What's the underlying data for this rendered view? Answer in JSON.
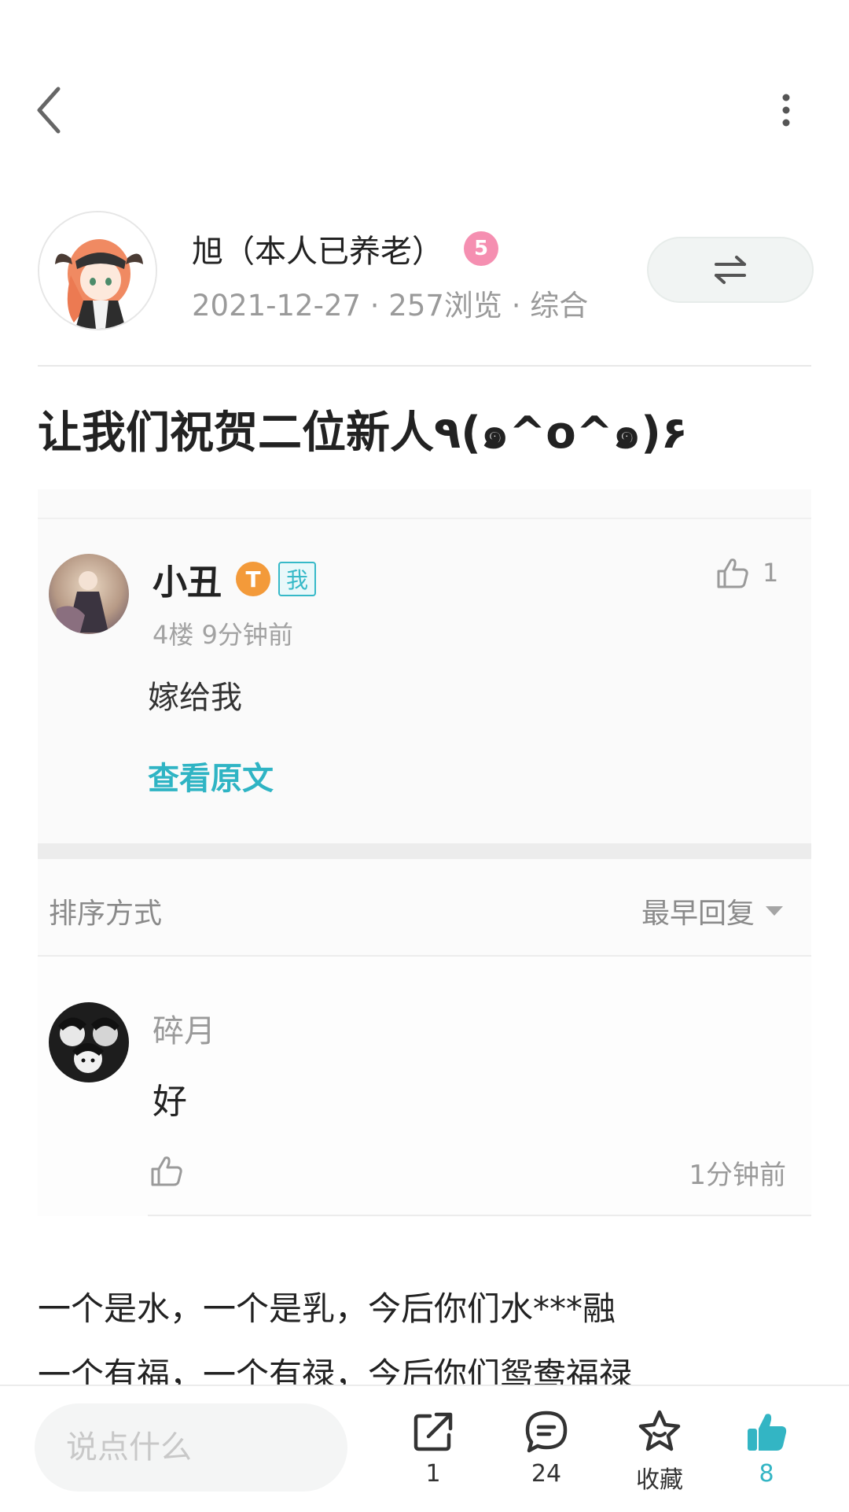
{
  "topbar": {
    "back_icon": "chevron-left-icon",
    "more_icon": "more-vertical-icon"
  },
  "author": {
    "name": "旭（本人已养老）",
    "level_badge": "5",
    "meta": "2021-12-27 · 257浏览 · 综合",
    "follow_icon": "swap-arrows-icon"
  },
  "post": {
    "title": "让我们祝贺二位新人٩(๑^o^๑)۶",
    "body_lines": [
      "一个是水，一个是乳，今后你们水***融",
      "一个有福，一个有禄，今后你们鸳鸯福禄"
    ]
  },
  "quoted_reply": {
    "name": "小丑",
    "level_badge": "T",
    "me_badge": "我",
    "meta": "4楼   9分钟前",
    "text": "嫁给我",
    "view_original": "查看原文",
    "like_count": "1"
  },
  "sort": {
    "label": "排序方式",
    "value": "最早回复"
  },
  "reply": {
    "name": "碎月",
    "text": "好",
    "time": "1分钟前"
  },
  "bottom": {
    "placeholder": "说点什么",
    "share_count": "1",
    "comment_count": "24",
    "favorite_label": "收藏",
    "like_count": "8",
    "accent_color": "#33b5c4"
  }
}
